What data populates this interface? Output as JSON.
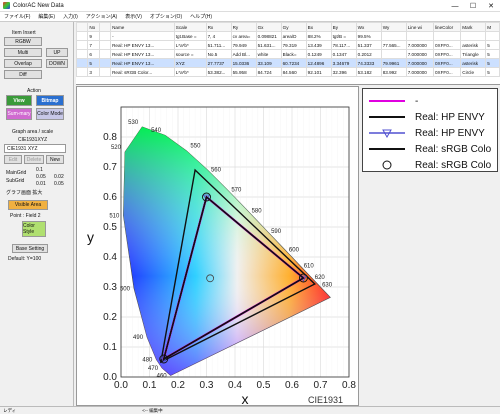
{
  "window": {
    "title": "ColorAC  New Data",
    "minimize": "—",
    "maximize": "☐",
    "close": "✕"
  },
  "menu": [
    "ファイル(F)",
    "編集(E)",
    "入力(I)",
    "アクション(A)",
    "表示(V)",
    "オプション(O)",
    "ヘルプ(H)"
  ],
  "left_panel": {
    "item_insert": "Item Insert",
    "rgbw": "RGBW",
    "multi": "Multi",
    "up": "UP",
    "overlap": "Overlap",
    "down": "DOWN",
    "diff": "Diff",
    "action": "Action",
    "view": "View",
    "bitmap": "Bitmap",
    "summary": "Sum-mary",
    "color_mode": "Color Mode",
    "graph_area": "Graph area / scale",
    "cie": "CIE1931XYZ",
    "cie_select": "CIE1931 XYZ",
    "edit": "Edit",
    "delete": "Delete",
    "new": "New",
    "main_grid": "MainGrid",
    "sub_grid": "SubGrid",
    "r1": "0.1",
    "r2": "0.05",
    "r3": "0.01",
    "r4": "0.02",
    "r5": "0.05",
    "graph_zoom": "グラフ画面 拡大",
    "visible_area": "Visible Area",
    "point": "Point : Field 2",
    "color_style": "Color Style",
    "base_setting": "Base Setting",
    "default_y": "Default: Y=100"
  },
  "grid": {
    "headers": [
      "",
      "No",
      "",
      "Name",
      "Scale",
      "Rx",
      "Ry",
      "Gx",
      "Gy",
      "Bx",
      "By",
      "Wx",
      "Wy",
      "Line wi",
      "lineColor",
      "Mark",
      "M"
    ],
    "rows": [
      [
        "",
        "9",
        "",
        "-",
        "tgt.Base =",
        "7, 4",
        "cv area=",
        "0.098821",
        "area/D",
        "88.2%",
        "tgt/B =",
        "99.5%",
        "",
        "",
        "",
        "",
        ""
      ],
      [
        "",
        "7",
        "",
        "Real: HP ENVY 13...",
        "L*a*b*",
        "51.711...",
        "79.949",
        "51.631...",
        "79.319",
        "13.439",
        "78.117...",
        "51.337",
        "77.565...",
        "7.000000",
        "0XFF0...",
        "asterisk",
        "5"
      ],
      [
        "",
        "6",
        "",
        "Real: HP ENVY 13...",
        "source =",
        "No.5",
        "Add Bl...",
        "white",
        "Black=",
        "0.1249",
        "0.1347",
        "0.2012",
        "",
        "7.000000",
        "0XFF0...",
        "Triangle",
        "5"
      ],
      [
        "",
        "5",
        "",
        "Real: HP ENVY 13...",
        "XYZ",
        "27.7737",
        "15.0336",
        "33.109",
        "60.7234",
        "12.4896",
        "3.34679",
        "74.3333",
        "79.9961",
        "7.000000",
        "0XFF0...",
        "asterisk",
        "5"
      ],
      [
        "",
        "3",
        "",
        "Real: sRGB Color...",
        "L*a*b*",
        "53.382...",
        "55.958",
        "84.724",
        "84.560",
        "92.101",
        "32.396",
        "53.182",
        "83.992",
        "7.000000",
        "0XFF0...",
        "Circle",
        "5"
      ]
    ],
    "selected_row": 3
  },
  "chart_data": {
    "type": "scatter",
    "xlabel": "x",
    "ylabel": "y",
    "xlim": [
      0.0,
      0.8
    ],
    "ylim": [
      0.0,
      0.9
    ],
    "x_ticks": [
      "0.0",
      "0.1",
      "0.2",
      "0.3",
      "0.4",
      "0.5",
      "0.6",
      "0.7",
      "0.8"
    ],
    "y_ticks": [
      "0.0",
      "0.1",
      "0.2",
      "0.3",
      "0.4",
      "0.5",
      "0.6",
      "0.7",
      "0.8"
    ],
    "watermark": "CIE1931",
    "wavelength_labels": [
      "460",
      "470",
      "480",
      "490",
      "500",
      "510",
      "520",
      "530",
      "540",
      "550",
      "560",
      "570",
      "580",
      "590",
      "600",
      "610",
      "620",
      "630"
    ],
    "spectral_locus": [
      [
        0.1741,
        0.005
      ],
      [
        0.144,
        0.0297
      ],
      [
        0.1241,
        0.0578
      ],
      [
        0.0913,
        0.1327
      ],
      [
        0.0454,
        0.295
      ],
      [
        0.0082,
        0.5384
      ],
      [
        0.0139,
        0.7502
      ],
      [
        0.0743,
        0.8338
      ],
      [
        0.1547,
        0.8059
      ],
      [
        0.2296,
        0.7543
      ],
      [
        0.3016,
        0.6923
      ],
      [
        0.3731,
        0.6245
      ],
      [
        0.4441,
        0.5547
      ],
      [
        0.5125,
        0.4866
      ],
      [
        0.5752,
        0.4242
      ],
      [
        0.627,
        0.3725
      ],
      [
        0.6658,
        0.334
      ],
      [
        0.6915,
        0.3083
      ],
      [
        0.7347,
        0.2653
      ]
    ],
    "series": [
      {
        "name": "-",
        "color": "#e000e0",
        "points": [
          [
            0.64,
            0.33
          ],
          [
            0.3,
            0.6
          ],
          [
            0.15,
            0.06
          ]
        ]
      },
      {
        "name": "Real: HP ENVY",
        "color": "#111111",
        "points": [
          [
            0.68,
            0.31
          ],
          [
            0.26,
            0.69
          ],
          [
            0.14,
            0.05
          ]
        ]
      },
      {
        "name": "Real: HP ENVY",
        "color": "#111111",
        "mark": "triangle",
        "points": [
          [
            0.64,
            0.33
          ],
          [
            0.3,
            0.6
          ],
          [
            0.15,
            0.06
          ]
        ]
      },
      {
        "name": "Real: sRGB Color",
        "color": "#111111",
        "points": [
          [
            0.64,
            0.33
          ],
          [
            0.3,
            0.6
          ],
          [
            0.15,
            0.06
          ]
        ]
      },
      {
        "name": "Real: sRGB Color",
        "color": "#111111",
        "mark": "circle",
        "points": [
          [
            0.64,
            0.33
          ],
          [
            0.3,
            0.6
          ],
          [
            0.15,
            0.06
          ]
        ]
      }
    ]
  },
  "legend": [
    {
      "label": "-",
      "color": "#e000e0",
      "mark": "none"
    },
    {
      "label": "Real: HP ENVY",
      "color": "#111111",
      "mark": "none"
    },
    {
      "label": "Real: HP ENVY",
      "color": "#5050d0",
      "mark": "triangle"
    },
    {
      "label": "Real: sRGB Colo",
      "color": "#111111",
      "mark": "none"
    },
    {
      "label": "Real: sRGB Colo",
      "color": "#111111",
      "mark": "circle"
    }
  ],
  "status": {
    "left": "レディ",
    "mid": "<-- 編集中"
  }
}
